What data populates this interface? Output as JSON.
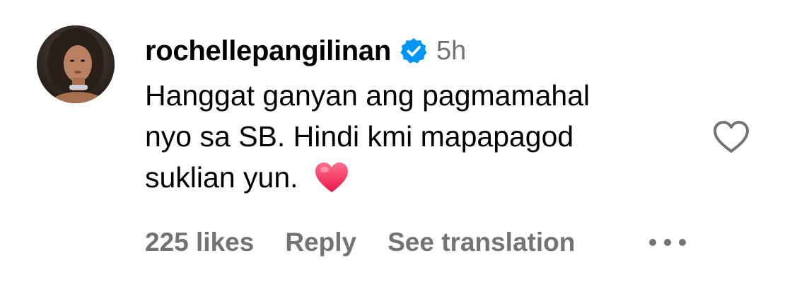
{
  "comment": {
    "username": "rochellepangilinan",
    "verified_icon": "verified-badge-icon",
    "timestamp": "5h",
    "text_lines": [
      "Hanggat ganyan ang pagmamahal",
      "nyo sa SB. Hindi kmi mapapagod",
      "suklian yun."
    ],
    "emoji_icon": "red-heart-emoji",
    "actions": {
      "likes": "225 likes",
      "reply": "Reply",
      "translate": "See translation"
    },
    "more_icon": "more-options-icon",
    "like_icon": "heart-outline-icon"
  },
  "colors": {
    "primary_text": "#000000",
    "secondary_text": "#737373",
    "verified_blue": "#0095f6",
    "emoji_red": "#f0305a"
  }
}
